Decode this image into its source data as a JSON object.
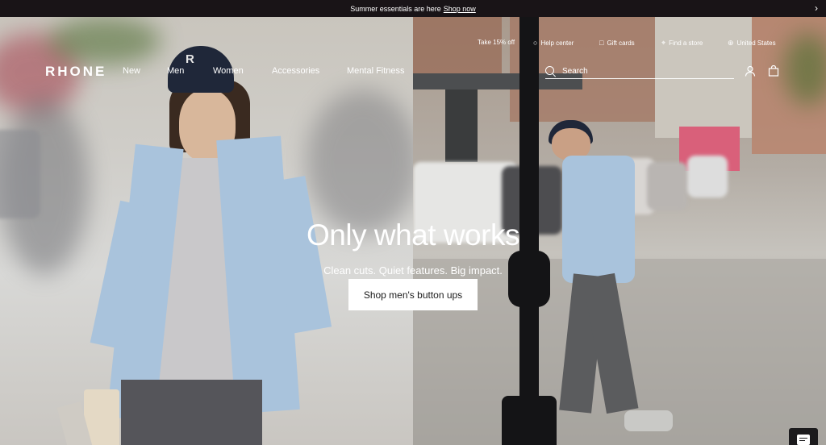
{
  "announcement": {
    "text": "Summer essentials are here",
    "link": "Shop now",
    "next_icon": "chevron-right-icon"
  },
  "header": {
    "logo": "RHONE",
    "nav": [
      "New",
      "Men",
      "Women",
      "Accessories",
      "Mental Fitness"
    ],
    "utility": [
      {
        "label": "Take 15% off",
        "icon": ""
      },
      {
        "label": "Help center",
        "icon": "help-circle-icon"
      },
      {
        "label": "Gift cards",
        "icon": "gift-icon"
      },
      {
        "label": "Find a store",
        "icon": "location-pin-icon"
      },
      {
        "label": "United States",
        "icon": "globe-icon"
      }
    ],
    "search_placeholder": "Search",
    "account_icon": "user-icon",
    "bag_icon": "shopping-bag-icon"
  },
  "hero": {
    "headline": "Only what works",
    "subheadline": "Clean cuts. Quiet features. Big impact.",
    "cta": "Shop men's button ups"
  },
  "chat": {
    "icon": "chat-icon"
  }
}
